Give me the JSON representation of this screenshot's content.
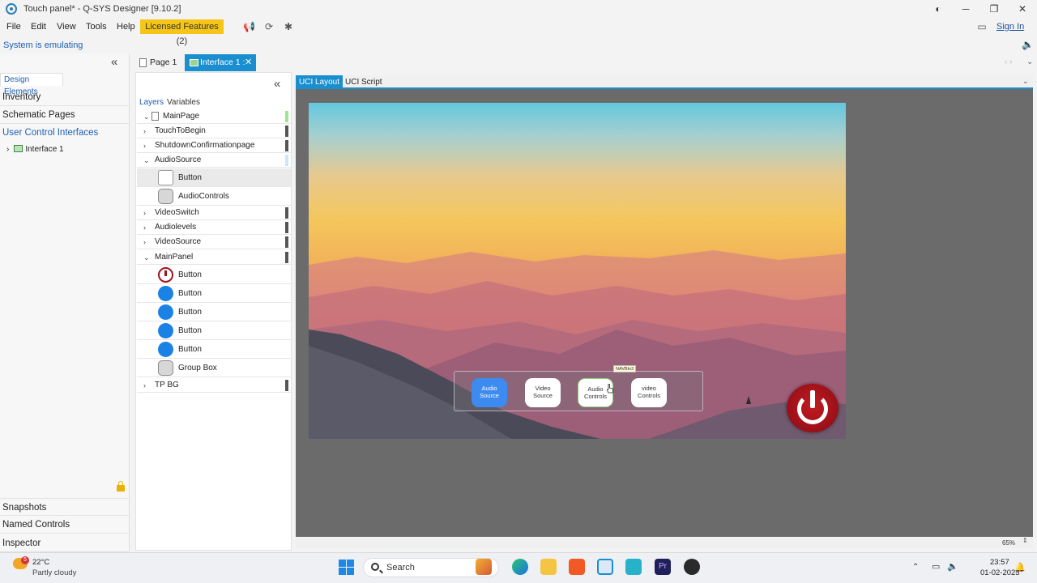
{
  "window": {
    "title": "Touch panel* - Q-SYS Designer [9.10.2]",
    "sign_in": "Sign In"
  },
  "menu": {
    "items": [
      "File",
      "Edit",
      "View",
      "Tools",
      "Help"
    ],
    "licensed": "Licensed Features (2)"
  },
  "status": {
    "emulating": "System is emulating"
  },
  "left_panel": {
    "design_elements_tab": "Design Elements",
    "items": [
      "Inventory",
      "Schematic Pages",
      "User Control Interfaces"
    ],
    "tree_child": "Interface 1",
    "bottom_items": [
      "Snapshots",
      "Named Controls",
      "Inspector"
    ]
  },
  "doc_tabs": {
    "page1": "Page 1",
    "interface": "Interface 1 :"
  },
  "layers_panel": {
    "tabs": [
      "Layers",
      "Variables"
    ],
    "main_page": "MainPage",
    "rows": {
      "touch_to_begin": "TouchToBegin",
      "shutdown": "ShutdownConfirmationpage",
      "audio_source": "AudioSource",
      "audio_source_children": [
        "Button",
        "AudioControls"
      ],
      "video_switch": "VideoSwitch",
      "audio_levels": "Audiolevels",
      "video_source": "VideoSource",
      "main_panel": "MainPanel",
      "main_panel_children": [
        "Button",
        "Button",
        "Button",
        "Button",
        "Button",
        "Group Box"
      ],
      "tp_bg": "TP BG"
    }
  },
  "uci_tabs": {
    "layout": "UCI Layout",
    "script": "UCI Script"
  },
  "canvas": {
    "nav_buttons": [
      {
        "line1": "Audio",
        "line2": "Source"
      },
      {
        "line1": "Video",
        "line2": "Source"
      },
      {
        "line1": "Audio",
        "line2": "Controls"
      },
      {
        "line1": "video",
        "line2": "Controls"
      }
    ],
    "tooltip": "NAVBtn3",
    "zoom": "65%"
  },
  "taskbar": {
    "weather_badge": "5",
    "temperature": "22°C",
    "condition": "Partly cloudy",
    "search": "Search",
    "time": "23:57",
    "date": "01-02-2025"
  },
  "colors": {
    "accent": "#1a8fd0",
    "licensed_bg": "#f5c518",
    "power_red": "#a1121a",
    "nav_active": "#3d8bf0"
  }
}
